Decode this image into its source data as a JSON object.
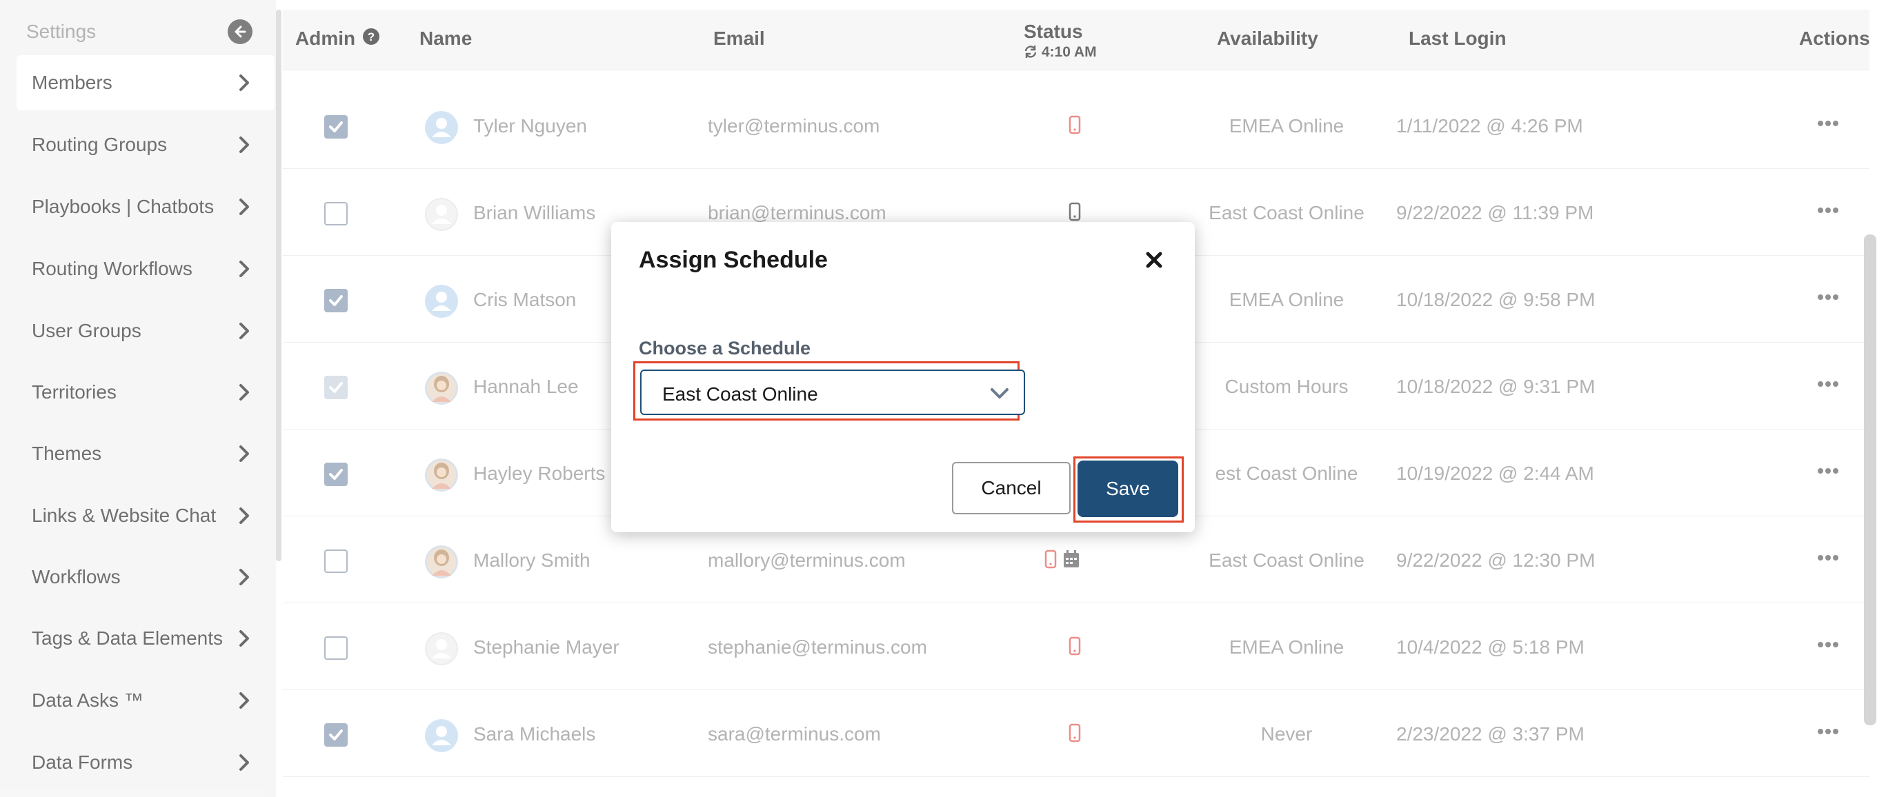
{
  "sidebar": {
    "header": "Settings",
    "items": [
      {
        "label": "Members",
        "active": true
      },
      {
        "label": "Routing Groups"
      },
      {
        "label": "Playbooks | Chatbots"
      },
      {
        "label": "Routing Workflows"
      },
      {
        "label": "User Groups"
      },
      {
        "label": "Territories"
      },
      {
        "label": "Themes"
      },
      {
        "label": "Links & Website Chat"
      },
      {
        "label": "Workflows"
      },
      {
        "label": "Tags & Data Elements"
      },
      {
        "label": "Data Asks ™"
      },
      {
        "label": "Data Forms"
      }
    ]
  },
  "table": {
    "headers": {
      "admin": "Admin",
      "name": "Name",
      "email": "Email",
      "status": "Status",
      "status_time": "4:10 AM",
      "availability": "Availability",
      "last_login": "Last Login",
      "actions": "Actions"
    },
    "rows": [
      {
        "admin": "checked",
        "name": "Tyler Nguyen",
        "email": "tyler@terminus.com",
        "status_icons": [
          "phone-red"
        ],
        "availability": "EMEA Online",
        "last_login": "1/11/2022 @ 4:26 PM",
        "avatar": "default-blue"
      },
      {
        "admin": "unchecked",
        "name": "Brian Williams",
        "email": "brian@terminus.com",
        "status_icons": [
          "phone-dark"
        ],
        "availability": "East Coast Online",
        "last_login": "9/22/2022 @ 11:39 PM",
        "avatar": "default-grey"
      },
      {
        "admin": "checked",
        "name": "Cris Matson",
        "email": "",
        "status_icons": [],
        "availability": "EMEA Online",
        "last_login": "10/18/2022 @ 9:58 PM",
        "avatar": "default-blue"
      },
      {
        "admin": "disabled-checked",
        "name": "Hannah Lee",
        "email": "",
        "status_icons": [],
        "availability": "Custom Hours",
        "last_login": "10/18/2022 @ 9:31 PM",
        "avatar": "photo"
      },
      {
        "admin": "checked",
        "name": "Hayley Roberts",
        "email": "",
        "status_icons": [],
        "availability": "est Coast Online",
        "last_login": "10/19/2022 @ 2:44 AM",
        "avatar": "photo"
      },
      {
        "admin": "unchecked",
        "name": "Mallory Smith",
        "email": "mallory@terminus.com",
        "status_icons": [
          "phone-red",
          "calendar"
        ],
        "availability": "East Coast Online",
        "last_login": "9/22/2022 @ 12:30 PM",
        "avatar": "photo"
      },
      {
        "admin": "unchecked",
        "name": "Stephanie Mayer",
        "email": "stephanie@terminus.com",
        "status_icons": [
          "phone-red"
        ],
        "availability": "EMEA Online",
        "last_login": "10/4/2022 @ 5:18 PM",
        "avatar": "default-grey"
      },
      {
        "admin": "checked",
        "name": "Sara Michaels",
        "email": "sara@terminus.com",
        "status_icons": [
          "phone-red"
        ],
        "availability": "Never",
        "last_login": "2/23/2022 @ 3:37 PM",
        "avatar": "default-blue"
      }
    ]
  },
  "modal": {
    "title": "Assign Schedule",
    "field_label": "Choose a Schedule",
    "selected_schedule": "East Coast Online",
    "cancel_label": "Cancel",
    "save_label": "Save"
  },
  "colors": {
    "primary": "#1f4e79",
    "highlight": "#e2442a",
    "phone_red": "#e0524a",
    "checkbox": "#7f92ad"
  }
}
